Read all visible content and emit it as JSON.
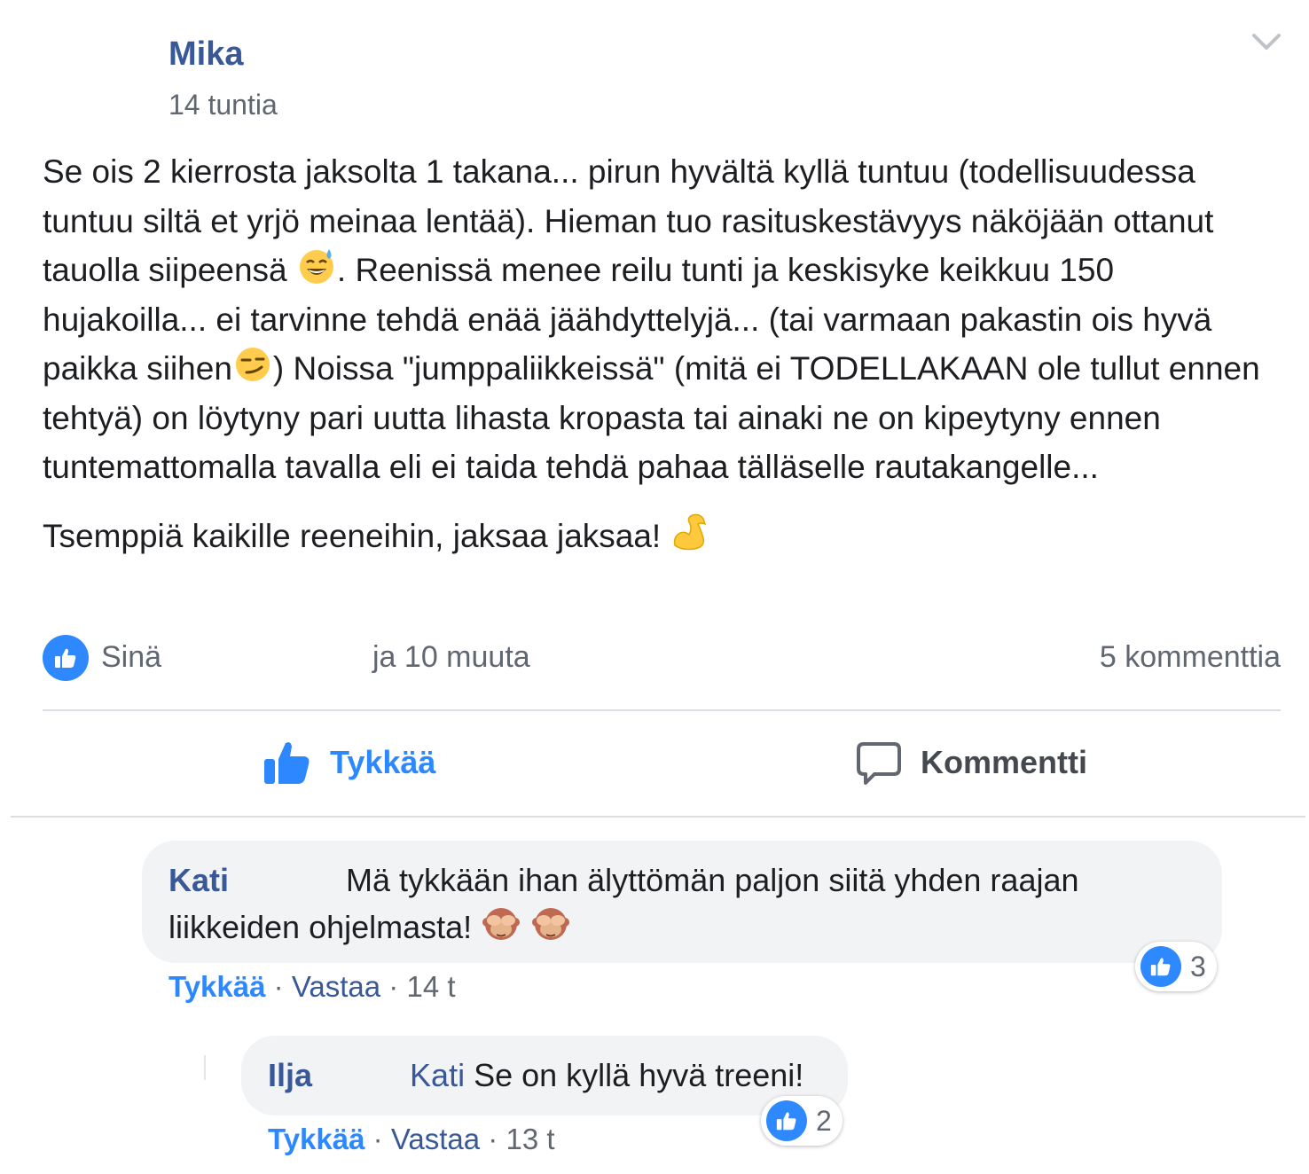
{
  "post": {
    "author": "Mika",
    "time": "14 tuntia",
    "paragraph1": "Se ois 2 kierrosta jaksolta 1 takana... pirun hyvältä kyllä tuntuu (todellisuudessa tuntuu siltä et yrjö meinaa lentää). Hieman tuo rasituskestävyys näköjään ottanut tauolla siipeensä",
    "emoji1": "sweat-smile-emoji",
    "paragraph1_cont": ". Reenissä menee reilu tunti ja keskisyke keikkuu 150 hujakoilla... ei tarvinne tehdä enää jäähdyttelyjä... (tai varmaan pakastin ois hyvä paikka siihen",
    "emoji2": "smirk-emoji",
    "paragraph1_end": ") Noissa \"jumppaliikkeissä\" (mitä ei TODELLAKAAN ole tullut ennen tehtyä) on löytyny pari uutta lihasta kropasta tai ainaki ne on kipeytyny ennen tuntemattomalla tavalla eli ei taida tehdä pahaa tälläselle rautakangelle...",
    "paragraph2": "Tsemppiä kaikille reeneihin, jaksaa jaksaa!",
    "emoji3": "flexed-biceps-emoji"
  },
  "reactions": {
    "you": "Sinä",
    "others": "ja 10 muuta",
    "comments": "5 kommenttia"
  },
  "actions": {
    "like": "Tykkää",
    "comment": "Kommentti"
  },
  "comments": [
    {
      "author": "Kati",
      "text": "Mä tykkään ihan älyttömän paljon siitä yhden raajan liikkeiden ohjelmasta!",
      "emoji": "see-no-evil-monkey-emoji",
      "likes": "3",
      "like_label": "Tykkää",
      "reply_label": "Vastaa",
      "time": "14 t"
    },
    {
      "author": "Ilja",
      "mention": "Kati",
      "text": "Se on kyllä hyvä treeni!",
      "likes": "2",
      "like_label": "Tykkää",
      "reply_label": "Vastaa",
      "time": "13 t"
    }
  ],
  "colors": {
    "link": "#385898",
    "accent": "#2d88ff",
    "muted": "#606770",
    "bubble": "#f2f3f5"
  }
}
